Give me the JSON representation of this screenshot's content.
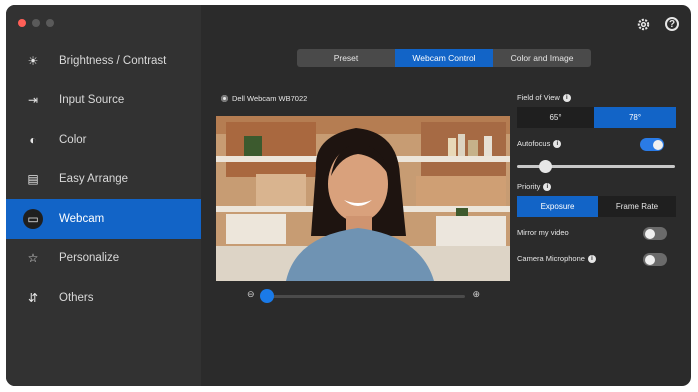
{
  "colors": {
    "accent": "#1264c7",
    "sidebar": "#323232",
    "window": "#2b2b2b"
  },
  "traffic_lights": [
    {
      "name": "close",
      "color": "#ff5f57"
    },
    {
      "name": "minimize",
      "color": "#5a5a5a"
    },
    {
      "name": "maximize",
      "color": "#5a5a5a"
    }
  ],
  "sidebar": {
    "items": [
      {
        "label": "Brightness / Contrast",
        "icon": "sun-icon",
        "glyph": "☀"
      },
      {
        "label": "Input Source",
        "icon": "input-source-icon",
        "glyph": "⇥"
      },
      {
        "label": "Color",
        "icon": "palette-icon",
        "glyph": "◐"
      },
      {
        "label": "Easy Arrange",
        "icon": "layout-icon",
        "glyph": "▤"
      },
      {
        "label": "Webcam",
        "icon": "webcam-icon",
        "glyph": "▭",
        "active": true
      },
      {
        "label": "Personalize",
        "icon": "star-icon",
        "glyph": "☆"
      },
      {
        "label": "Others",
        "icon": "others-icon",
        "glyph": "⇵"
      }
    ]
  },
  "header": {
    "settings_icon": "gear-icon",
    "help_icon": "question-icon",
    "help_glyph": "?"
  },
  "tabs": [
    {
      "label": "Preset"
    },
    {
      "label": "Webcam Control",
      "active": true
    },
    {
      "label": "Color and Image"
    }
  ],
  "camera": {
    "label": "Dell Webcam WB7022"
  },
  "zoom": {
    "value": 0.0,
    "min_icon": "zoom-out-icon",
    "max_icon": "zoom-in-icon",
    "min_glyph": "⊖",
    "max_glyph": "⊕"
  },
  "controls": {
    "field_of_view": {
      "label": "Field of View",
      "options": [
        "65°",
        "78°"
      ],
      "selected": "78°"
    },
    "autofocus": {
      "label": "Autofocus",
      "on": true
    },
    "focus_slider": {
      "value": 0.15
    },
    "priority": {
      "label": "Priority",
      "options": [
        "Exposure",
        "Frame Rate"
      ],
      "selected": "Exposure"
    },
    "mirror": {
      "label": "Mirror my video",
      "on": false
    },
    "microphone": {
      "label": "Camera Microphone",
      "on": false
    }
  }
}
